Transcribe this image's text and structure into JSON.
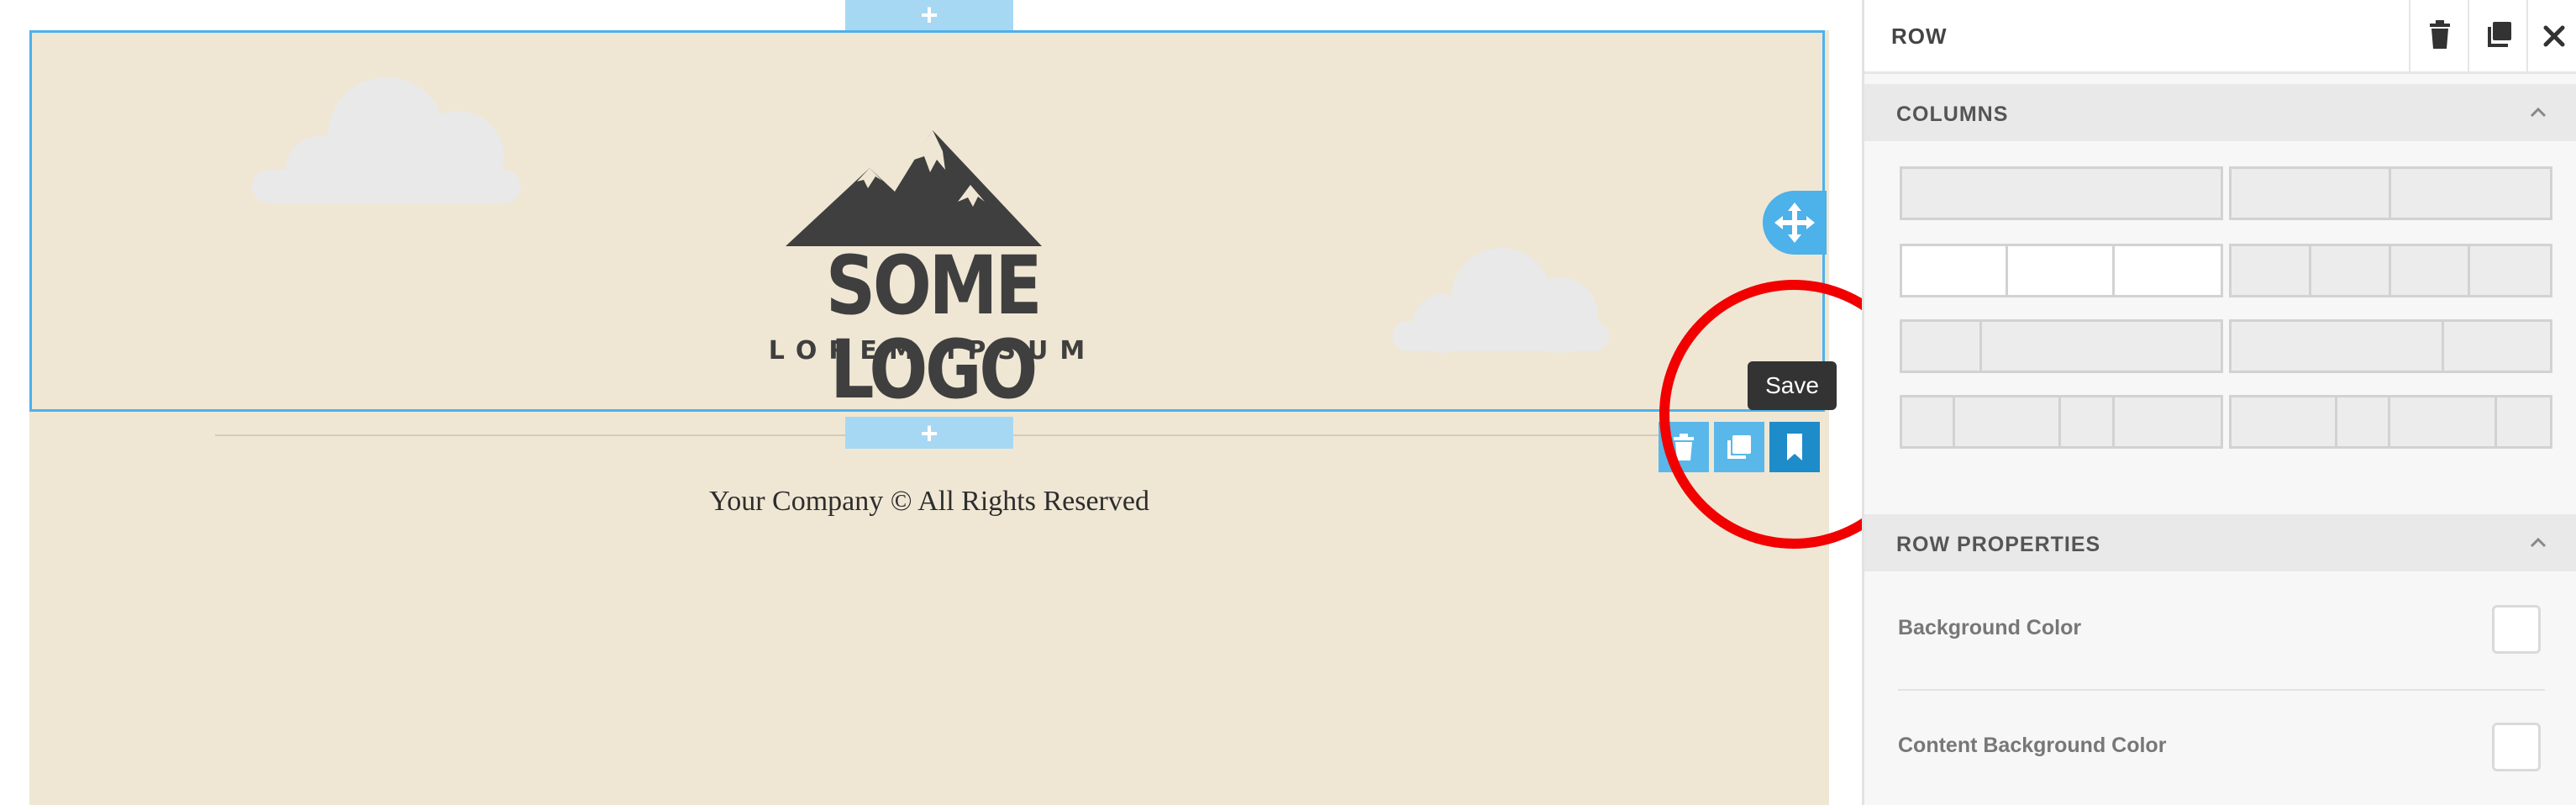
{
  "canvas": {
    "add_row_label": "+",
    "logo": {
      "title": "SOME LOGO",
      "subtitle": "LOREM IPSUM"
    },
    "footer_text": "Your Company © All Rights Reserved",
    "tooltip": "Save",
    "row_tools": [
      "trash-icon",
      "duplicate-icon",
      "bookmark-icon"
    ],
    "handle_icon": "move-icon"
  },
  "panel": {
    "title": "ROW",
    "header_buttons": [
      "trash-icon",
      "duplicate-icon",
      "close-icon"
    ],
    "columns_section": {
      "title": "COLUMNS",
      "layouts": [
        {
          "cols": [
            1
          ],
          "selected": false
        },
        {
          "cols": [
            1,
            1
          ],
          "selected": false
        },
        {
          "cols": [
            1,
            1,
            1
          ],
          "selected": true
        },
        {
          "cols": [
            1,
            1,
            1,
            1
          ],
          "selected": false
        },
        {
          "cols": [
            1,
            3
          ],
          "selected": false
        },
        {
          "cols": [
            2,
            1
          ],
          "selected": false
        },
        {
          "cols": [
            1,
            2,
            1,
            2
          ],
          "selected": false
        },
        {
          "cols": [
            2,
            1,
            2,
            1
          ],
          "selected": false
        }
      ]
    },
    "row_properties": {
      "title": "ROW PROPERTIES",
      "background_color_label": "Background Color",
      "content_background_color_label": "Content Background Color"
    }
  },
  "colors": {
    "accent": "#4db1ea",
    "annotation": "#f20000",
    "page_bg": "#efe7d4"
  }
}
